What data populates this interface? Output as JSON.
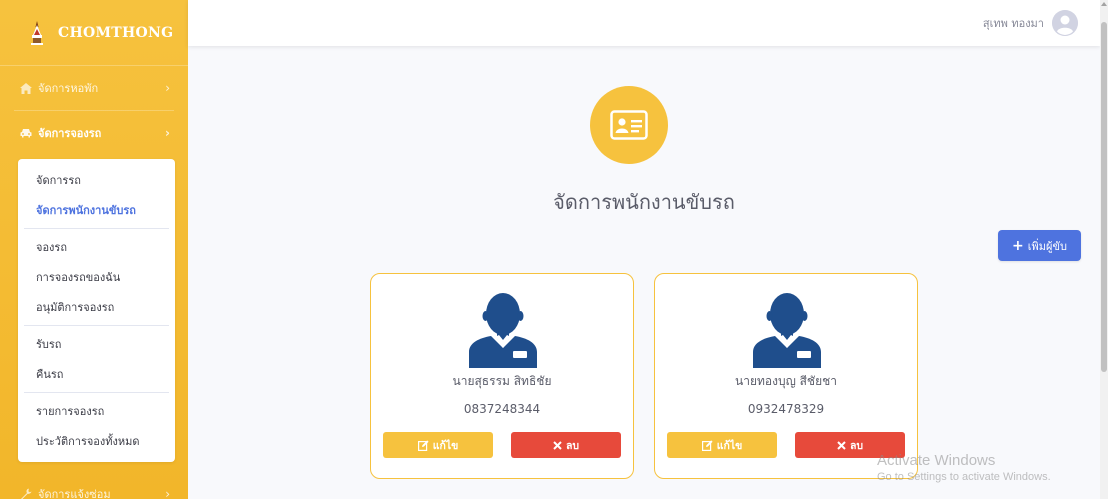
{
  "brand": {
    "name": "CHOMTHONG"
  },
  "sidebar": {
    "items": [
      {
        "label": "จัดการหอพัก",
        "icon": "home-icon",
        "active": false
      },
      {
        "label": "จัดการจองรถ",
        "icon": "car-icon",
        "active": true
      },
      {
        "label": "จัดการแจ้งซ่อม",
        "icon": "wrench-icon",
        "active": false
      }
    ],
    "submenu": {
      "groups": [
        [
          "จัดการรถ",
          "จัดการพนักงานขับรถ"
        ],
        [
          "จองรถ",
          "การจองรถของฉัน",
          "อนุมัติการจองรถ"
        ],
        [
          "รับรถ",
          "คืนรถ"
        ],
        [
          "รายการจองรถ",
          "ประวัติการจองทั้งหมด"
        ]
      ],
      "active_label": "จัดการพนักงานขับรถ"
    }
  },
  "topbar": {
    "user_name": "สุเทพ ทองมา",
    "avatar_icon": "user-circle-icon"
  },
  "main": {
    "page_icon": "id-card-icon",
    "title": "จัดการพนักงานขับรถ",
    "add_button_label": "เพิ่มผู้ขับ",
    "drivers": [
      {
        "name": "นายสุธรรม สิทธิชัย",
        "phone": "0837248344",
        "edit_label": "แก้ไข",
        "delete_label": "ลบ"
      },
      {
        "name": "นายทองบุญ สีชัยชา",
        "phone": "0932478329",
        "edit_label": "แก้ไข",
        "delete_label": "ลบ"
      }
    ]
  },
  "watermark": {
    "title": "Activate Windows",
    "subtitle": "Go to Settings to activate Windows."
  },
  "colors": {
    "sidebar": "#f6c23e",
    "primary": "#4e73df",
    "danger": "#e74a3b",
    "warning": "#f6c23e",
    "driver_icon": "#1f4e8c"
  }
}
